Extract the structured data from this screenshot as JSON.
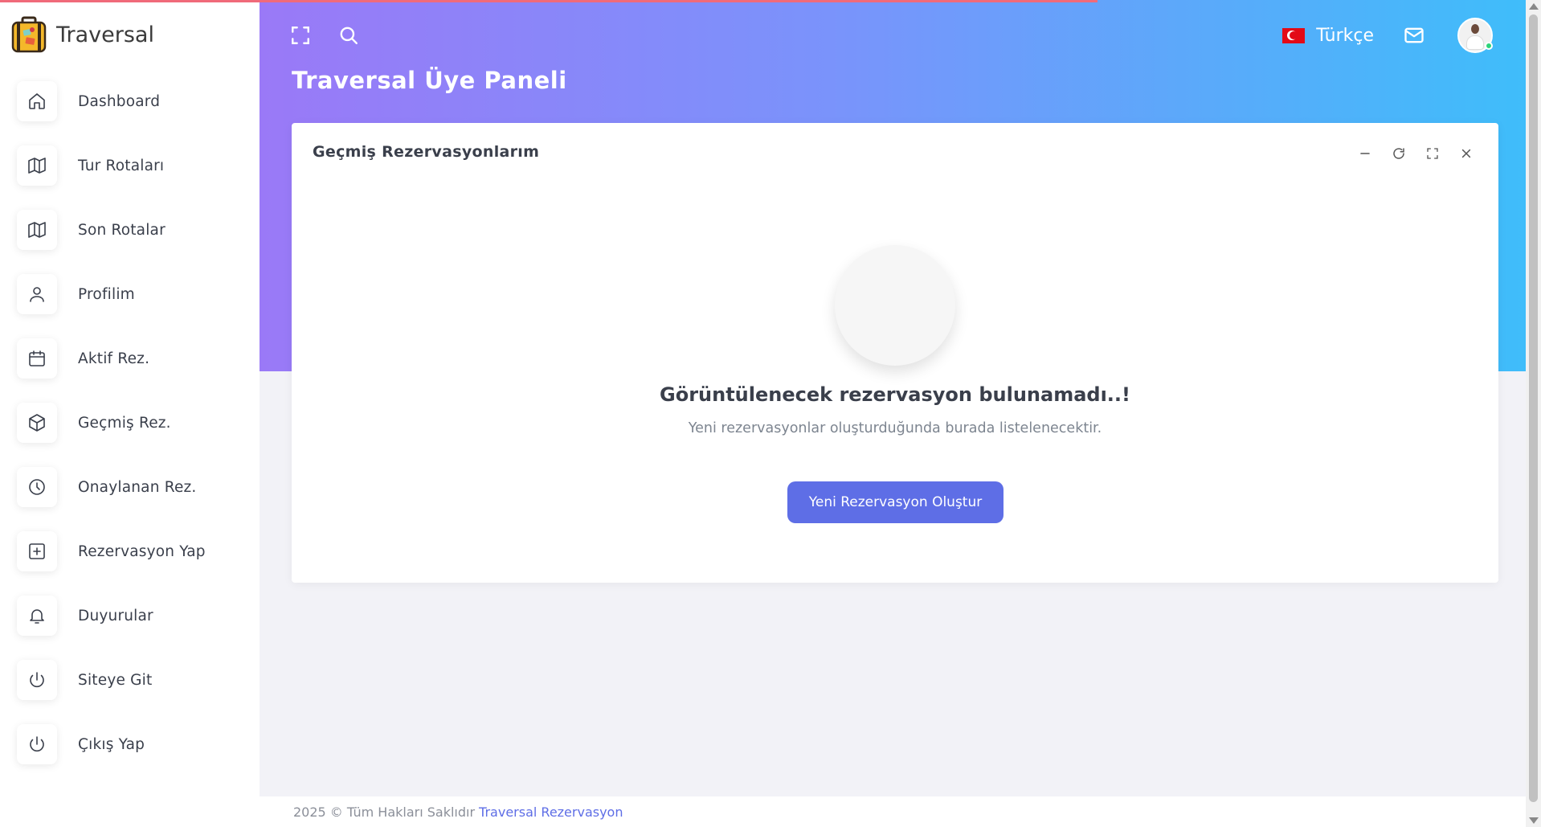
{
  "app": {
    "brand_name": "Traversal",
    "page_title": "Traversal Üye Paneli"
  },
  "colors": {
    "accent": "#5e6ee6",
    "gradient_start": "#9a79f7",
    "gradient_end": "#3fbdfa",
    "progress": "#f06a7a",
    "online_status": "#2ed47a"
  },
  "sidebar": {
    "items": [
      {
        "label": "Dashboard",
        "icon": "home-icon"
      },
      {
        "label": "Tur Rotaları",
        "icon": "map-icon"
      },
      {
        "label": "Son Rotalar",
        "icon": "map-icon"
      },
      {
        "label": "Profilim",
        "icon": "user-icon"
      },
      {
        "label": "Aktif Rez.",
        "icon": "calendar-icon"
      },
      {
        "label": "Geçmiş Rez.",
        "icon": "box-icon"
      },
      {
        "label": "Onaylanan Rez.",
        "icon": "clock-icon"
      },
      {
        "label": "Rezervasyon Yap",
        "icon": "plus-square-icon"
      },
      {
        "label": "Duyurular",
        "icon": "bell-icon"
      },
      {
        "label": "Siteye Git",
        "icon": "power-icon"
      },
      {
        "label": "Çıkış Yap",
        "icon": "power-icon"
      }
    ]
  },
  "topbar": {
    "language": "Türkçe",
    "icons": [
      "fullscreen-icon",
      "search-icon",
      "mail-icon"
    ]
  },
  "card": {
    "title": "Geçmiş Rezervasyonlarım",
    "tools": [
      "minimize-icon",
      "refresh-icon",
      "expand-icon",
      "close-icon"
    ],
    "empty_title": "Görüntülenecek rezervasyon bulunamadı..!",
    "empty_subtitle": "Yeni rezervasyonlar oluşturduğunda burada listelenecektir.",
    "button_label": "Yeni Rezervasyon Oluştur"
  },
  "footer": {
    "text": "2025 © Tüm Hakları Saklıdır",
    "link": "Traversal Rezervasyon"
  }
}
